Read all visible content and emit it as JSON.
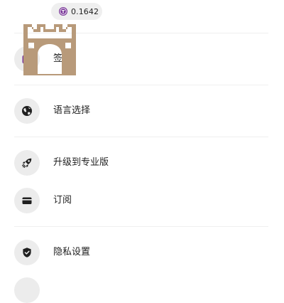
{
  "balance": {
    "token_icon": "token-t-icon",
    "token_letter": "T",
    "value": "0.1642",
    "token_color": "#7c3a9a"
  },
  "overlay": {
    "logo_icon": "castle-gate-logo",
    "color": "#b89a7a"
  },
  "menu": {
    "items": [
      {
        "label": "签到",
        "icon": "calendar-check-icon",
        "icon_color": "#7c3a9a"
      },
      {
        "label": "语言选择",
        "icon": "globe-icon"
      },
      {
        "label": "升级到专业版",
        "icon": "rocket-icon"
      },
      {
        "label": "订阅",
        "icon": "credit-card-icon"
      },
      {
        "label": "隐私设置",
        "icon": "shield-check-icon"
      }
    ]
  },
  "colors": {
    "icon_circle_bg": "#ececec",
    "divider": "#efefef",
    "text": "#1f1f1f"
  }
}
